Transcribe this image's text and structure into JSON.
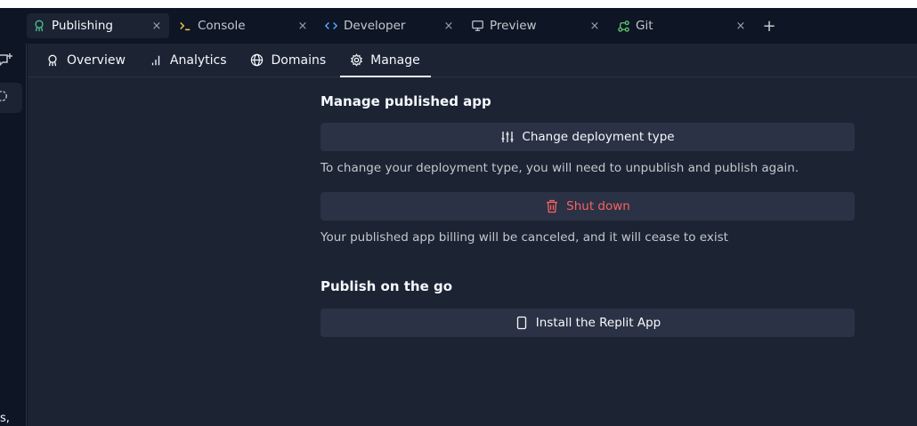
{
  "tabs": [
    {
      "label": "Publishing",
      "icon": "publishing-icon",
      "active": true
    },
    {
      "label": "Console",
      "icon": "console-icon"
    },
    {
      "label": "Developer",
      "icon": "code-icon"
    },
    {
      "label": "Preview",
      "icon": "monitor-icon"
    },
    {
      "label": "Git",
      "icon": "git-icon"
    }
  ],
  "tab_close_glyph": "×",
  "add_tab_glyph": "+",
  "left": {
    "snippet": "s,"
  },
  "subnav": [
    {
      "label": "Overview",
      "icon": "publishing-icon"
    },
    {
      "label": "Analytics",
      "icon": "bar-chart-icon"
    },
    {
      "label": "Domains",
      "icon": "globe-icon"
    },
    {
      "label": "Manage",
      "icon": "gear-icon",
      "active": true
    }
  ],
  "manage": {
    "title": "Manage published app",
    "change_button": "Change deployment type",
    "change_note": "To change your deployment type, you will need to unpublish and publish again.",
    "shutdown_button": "Shut down",
    "shutdown_note": "Your published app billing will be canceled, and it will cease to exist"
  },
  "go": {
    "title": "Publish on the go",
    "install_button": "Install the Replit App"
  },
  "colors": {
    "background": "#0e1525",
    "panel": "#1c2333",
    "button": "#2b3245",
    "danger": "#f86262",
    "publishing_accent": "#4fc08d",
    "console_accent": "#f3c94c",
    "code_accent": "#57abff",
    "git_accent": "#62c96c"
  }
}
